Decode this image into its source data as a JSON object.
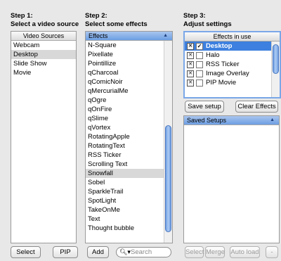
{
  "steps": [
    {
      "line1": "Step 1:",
      "line2": "Select a video source"
    },
    {
      "line1": "Step 2:",
      "line2": "Select some effects"
    },
    {
      "line1": "Step 3:",
      "line2": "Adjust settings"
    }
  ],
  "video_sources": {
    "header": "Video Sources",
    "items": [
      "Webcam",
      "Desktop",
      "Slide Show",
      "Movie"
    ],
    "selected_index": 1
  },
  "effects": {
    "header": "Effects",
    "items": [
      "N-Square",
      "Pixellate",
      "Pointillize",
      "qCharcoal",
      "qComicNoir",
      "qMercurialMe",
      "qOgre",
      "qOnFire",
      "qSlime",
      "qVortex",
      "RotatingApple",
      "RotatingText",
      "RSS Ticker",
      "Scrolling Text",
      "Snowfall",
      "Sobel",
      "SparkleTrail",
      "SpotLight",
      "TakeOnMe",
      "Text",
      "Thought bubble"
    ],
    "selected_index": 14
  },
  "effects_in_use": {
    "header": "Effects in use",
    "items": [
      {
        "label": "Desktop",
        "checked": true
      },
      {
        "label": "Halo",
        "checked": false
      },
      {
        "label": "RSS Ticker",
        "checked": false
      },
      {
        "label": "Image Overlay",
        "checked": false
      },
      {
        "label": "PIP Movie",
        "checked": false
      }
    ]
  },
  "buttons": {
    "save_setup": "Save setup",
    "clear_effects": "Clear Effects",
    "select": "Select",
    "pip": "PIP",
    "add": "Add",
    "select_saved": "Select",
    "merge": "Merge",
    "auto_load": "Auto load",
    "remove": "-"
  },
  "search": {
    "placeholder": "Search"
  },
  "saved_setups": {
    "header": "Saved Setups"
  },
  "colors": {
    "selection_blue": "#3d80df",
    "list_selected_gray": "#d8d8d8"
  }
}
